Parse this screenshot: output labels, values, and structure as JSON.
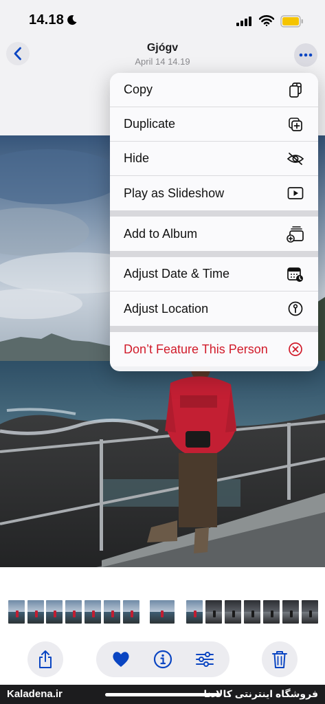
{
  "status_bar": {
    "time": "14.18"
  },
  "nav": {
    "title": "Gjógv",
    "subtitle": "April 14  14.19"
  },
  "menu": {
    "copy": "Copy",
    "duplicate": "Duplicate",
    "hide": "Hide",
    "slideshow": "Play as Slideshow",
    "add_to_album": "Add to Album",
    "adjust_date": "Adjust Date & Time",
    "adjust_location": "Adjust Location",
    "dont_feature": "Don’t Feature This Person"
  },
  "watermark": {
    "left": "Kaladena.ir",
    "right": "فروشگاه اینترنتی کالادنا"
  },
  "colors": {
    "accent": "#0a45c2",
    "destructive": "#d11b2a",
    "battery": "#f5c400"
  }
}
